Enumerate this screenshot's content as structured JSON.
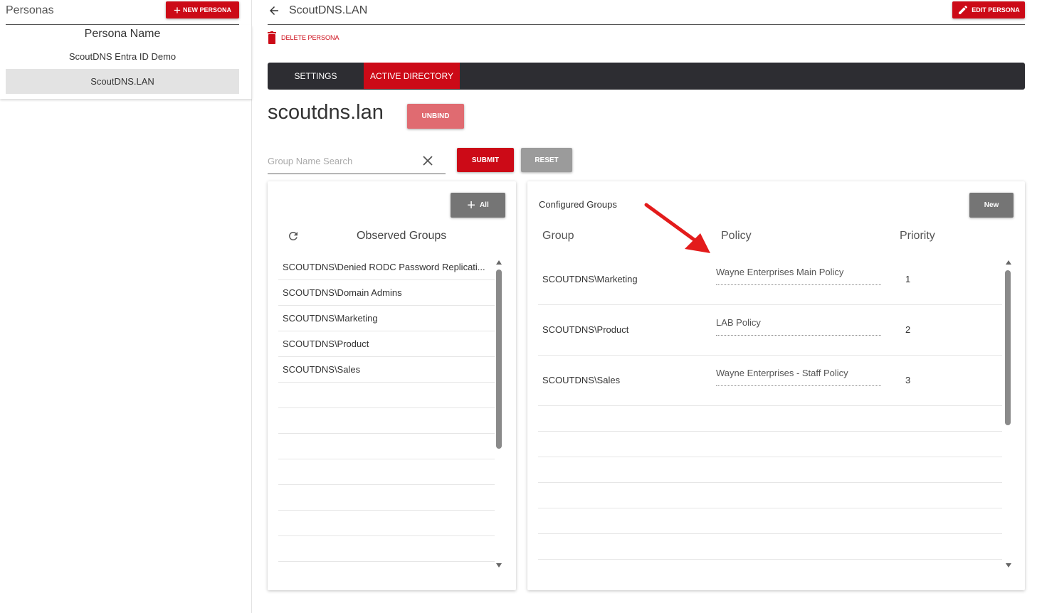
{
  "sidebar": {
    "title": "Personas",
    "new_button": "NEW PERSONA",
    "column_header": "Persona Name",
    "items": [
      {
        "label": "ScoutDNS Entra ID Demo",
        "selected": false
      },
      {
        "label": "ScoutDNS.LAN",
        "selected": true
      }
    ]
  },
  "header": {
    "title": "ScoutDNS.LAN",
    "edit_button": "EDIT PERSONA",
    "delete_label": "DELETE PERSONA"
  },
  "tabs": [
    {
      "label": "SETTINGS",
      "active": false
    },
    {
      "label": "ACTIVE DIRECTORY",
      "active": true
    }
  ],
  "domain": {
    "name": "scoutdns.lan",
    "unbind_button": "UNBIND"
  },
  "search": {
    "placeholder": "Group Name Search",
    "value": "",
    "submit_button": "SUBMIT",
    "reset_button": "RESET"
  },
  "observed": {
    "add_all_button": "All",
    "title": "Observed Groups",
    "groups": [
      "SCOUTDNS\\Denied RODC Password Replicati...",
      "SCOUTDNS\\Domain Admins",
      "SCOUTDNS\\Marketing",
      "SCOUTDNS\\Product",
      "SCOUTDNS\\Sales"
    ]
  },
  "configured": {
    "title": "Configured Groups",
    "new_button": "New",
    "columns": {
      "group": "Group",
      "policy": "Policy",
      "priority": "Priority"
    },
    "rows": [
      {
        "group": "SCOUTDNS\\Marketing",
        "policy": "Wayne Enterprises  Main Policy",
        "priority": "1"
      },
      {
        "group": "SCOUTDNS\\Product",
        "policy": "LAB Policy",
        "priority": "2"
      },
      {
        "group": "SCOUTDNS\\Sales",
        "policy": "Wayne Enterprises - Staff Policy",
        "priority": "3"
      }
    ]
  },
  "colors": {
    "accent_red": "#cc0a17",
    "tabbar_dark": "#2d2d32",
    "unbind_pink": "#e06b71",
    "grey_button": "#757575"
  }
}
